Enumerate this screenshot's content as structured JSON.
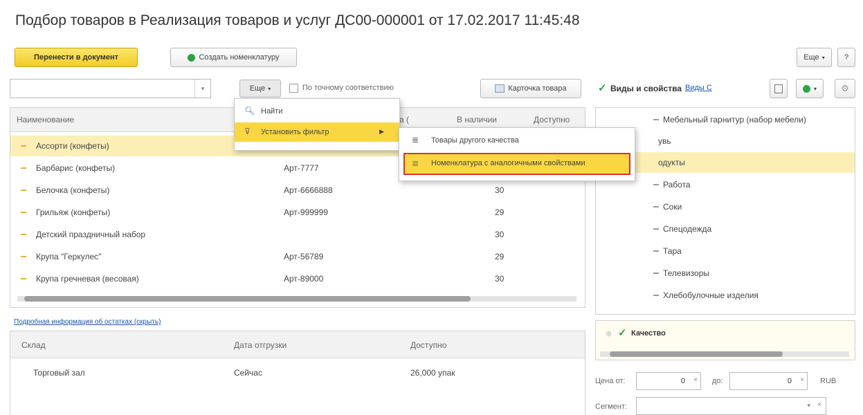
{
  "window": {
    "title": "Подбор товаров в Реализация товаров и услуг ДС00-000001 от 17.02.2017 11:45:48"
  },
  "toolbar": {
    "transfer_label": "Перенести в документ",
    "create_label": "Создать номенклатуру",
    "more_label": "Еще",
    "help_label": "?"
  },
  "search": {
    "value": "",
    "more_label": "Еще",
    "exact_label": "По точному соответствию",
    "card_label": "Карточка товара"
  },
  "table": {
    "headers": {
      "name": "Наименование",
      "art": "а (",
      "stock": "В наличии",
      "avail": "Доступно"
    },
    "rows": [
      {
        "name": "Ассорти (конфеты)",
        "art": "",
        "stock": "",
        "selected": true
      },
      {
        "name": "Барбарис (конфеты)",
        "art": "Арт-7777",
        "stock": ""
      },
      {
        "name": "Белочка (конфеты)",
        "art": "Арт-6666888",
        "stock": "30"
      },
      {
        "name": "Грильяж (конфеты)",
        "art": "Арт-999999",
        "stock": "29"
      },
      {
        "name": "Детский праздничный набор",
        "art": "",
        "stock": "30"
      },
      {
        "name": "Крупа \"Геркулес\"",
        "art": "Арт-56789",
        "stock": "29"
      },
      {
        "name": "Крупа гречневая (весовая)",
        "art": "Арт-89000",
        "stock": "30"
      }
    ]
  },
  "menu": {
    "find": "Найти",
    "set_filter": "Установить фильтр",
    "sub_other_quality": "Товары другого качества",
    "sub_similar": "Номенклатура с аналогичными свойствами"
  },
  "details": {
    "link": "Подробная информация об остатках (скрыть)",
    "headers": {
      "warehouse": "Склад",
      "date": "Дата отгрузки",
      "avail": "Доступно"
    },
    "row": {
      "warehouse": "Торговый зал",
      "date": "Сейчас",
      "avail": "26,000 упак"
    }
  },
  "right": {
    "props_label": "Виды и свойства",
    "props_links": "Виды С",
    "items": [
      "Мебельный гарнитур (набор мебели)",
      "увь",
      "одукты",
      "Работа",
      "Соки",
      "Спецодежда",
      "Тара",
      "Телевизоры",
      "Хлебобулочные изделия"
    ],
    "quality_label": "Качество",
    "price_from_label": "Цена от:",
    "price_from": "0",
    "price_to_label": "до:",
    "price_to": "0",
    "currency": "RUB",
    "segment_label": "Сегмент:"
  },
  "colors": {
    "accent_yellow": "#f8d742",
    "highlight_red": "#e0312b",
    "row_selected": "#fbefb6"
  }
}
